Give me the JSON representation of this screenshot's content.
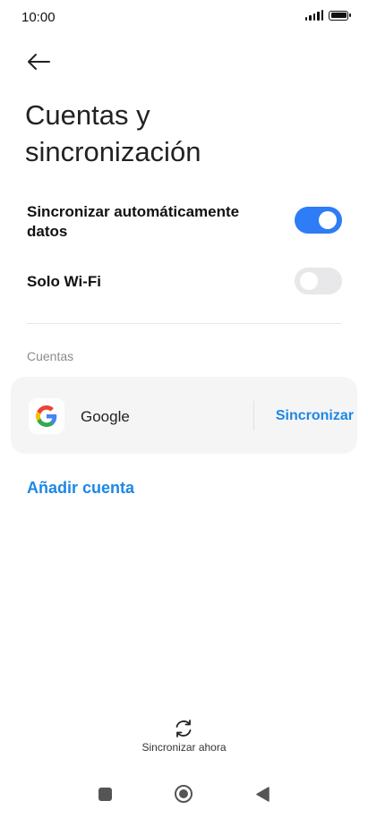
{
  "status_bar": {
    "time": "10:00"
  },
  "page": {
    "title_line1": "Cuentas y",
    "title_line2": "sincronización"
  },
  "settings": {
    "auto_sync_line1": "Sincronizar automáticamente",
    "auto_sync_line2": "datos",
    "auto_sync_enabled": true,
    "wifi_only_label": "Solo Wi-Fi",
    "wifi_only_enabled": false
  },
  "accounts": {
    "section_label": "Cuentas",
    "items": [
      {
        "name": "Google",
        "action_label": "Sincronizar"
      }
    ],
    "add_label": "Añadir cuenta"
  },
  "footer": {
    "sync_now_label": "Sincronizar ahora"
  },
  "colors": {
    "accent": "#2e7cf6",
    "link": "#1d87e4",
    "toggle_off": "#e8e8ea"
  }
}
